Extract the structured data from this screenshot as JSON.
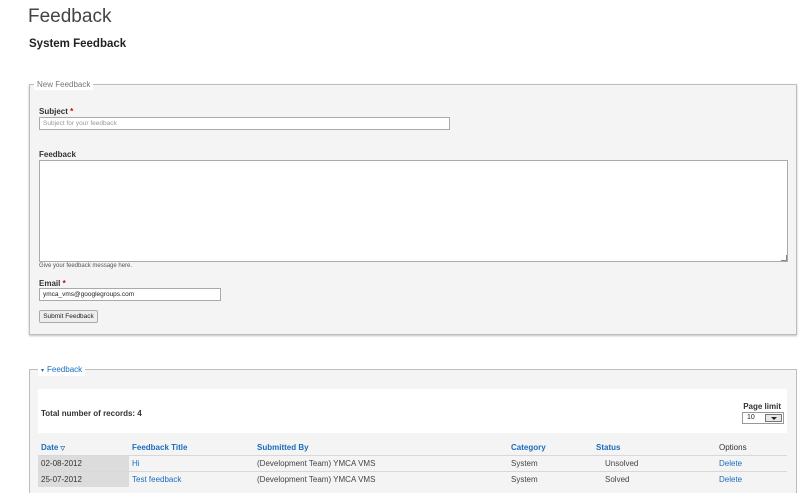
{
  "page": {
    "title": "Feedback",
    "section_title": "System Feedback"
  },
  "new_feedback": {
    "legend": "New Feedback",
    "subject_label": "Subject",
    "required_mark": "*",
    "subject_placeholder": "Subject for your feedback",
    "feedback_label": "Feedback",
    "feedback_hint": "Give your feedback message here.",
    "email_label": "Email",
    "email_value": "ymca_vms@googlegroups.com",
    "submit_label": "Submit Feedback"
  },
  "feedback_list": {
    "legend": "Feedback",
    "total_records_text": "Total number of records: 4",
    "page_limit_label": "Page limit",
    "page_limit_value": "10",
    "columns": {
      "date": "Date",
      "title": "Feedback Title",
      "submitted_by": "Submitted By",
      "category": "Category",
      "status": "Status",
      "options": "Options"
    },
    "rows": [
      {
        "date": "02-08-2012",
        "title": "Hi",
        "submitted_by": "(Development Team) YMCA VMS",
        "category": "System",
        "status": "Unsolved",
        "option": "Delete"
      },
      {
        "date": "25-07-2012",
        "title": "Test feedback",
        "submitted_by": "(Development Team) YMCA VMS",
        "category": "System",
        "status": "Solved",
        "option": "Delete"
      }
    ]
  },
  "colors": {
    "link": "#1a6dbf",
    "required": "#cc0000",
    "panel_bg": "#f4f4f4"
  }
}
